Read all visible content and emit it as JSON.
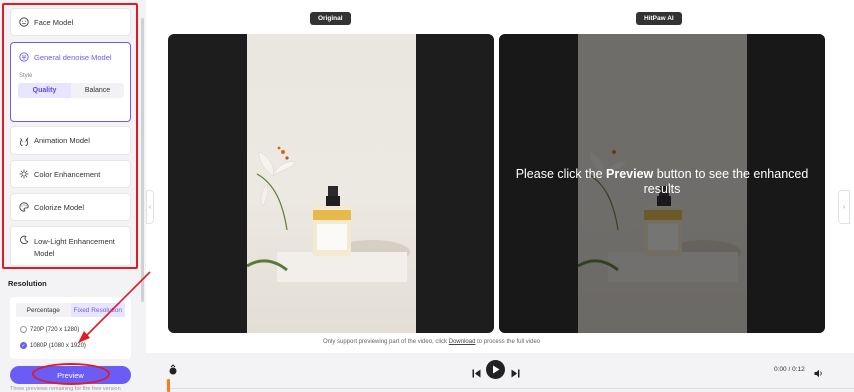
{
  "sidebar": {
    "models": [
      {
        "label": "Face Model",
        "icon": "face-icon"
      },
      {
        "label": "General denoise Model",
        "icon": "denoise-icon",
        "selected": true
      },
      {
        "label": "Animation Model",
        "icon": "animation-icon"
      },
      {
        "label": "Color Enhancement",
        "icon": "sun-icon"
      },
      {
        "label": "Colorize Model",
        "icon": "palette-icon"
      },
      {
        "label": "Low-Light Enhancement Model",
        "icon": "moon-icon"
      }
    ],
    "style_label": "Style",
    "style_options": [
      "Quality",
      "Balance"
    ],
    "style_selected": "Quality"
  },
  "resolution": {
    "title": "Resolution",
    "tabs": [
      "Percentage",
      "Fixed Resolution"
    ],
    "options": [
      "720P (720 x 1280)",
      "1080P (1080 x 1920)"
    ],
    "selected": "1080P (1080 x 1920)"
  },
  "preview_button": "Preview",
  "footnote": "Three previews remaining for the free version",
  "original_label": "Original",
  "hitpaw_label": "HitPaw AI",
  "enhanced_msg": {
    "before": "Please click the",
    "bold": "Preview",
    "after": "button to see the enhanced results"
  },
  "note": {
    "before": "Only support previewing part of the video, click",
    "link": "Download",
    "after": "to process the full video"
  },
  "time": "0:00 / 0:12",
  "colors": {
    "accent": "#6b5cf6",
    "annotation": "#e01b24",
    "progress": "#ff7a1a"
  }
}
